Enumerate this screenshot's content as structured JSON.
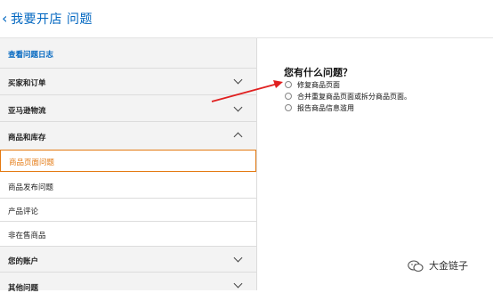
{
  "header": {
    "back_icon": "chevron-left-icon",
    "title": "我要开店 问题"
  },
  "sidebar": {
    "log_link": "查看问题日志",
    "sections": [
      {
        "label": "买家和订单",
        "expanded": false
      },
      {
        "label": "亚马逊物流",
        "expanded": false
      },
      {
        "label": "商品和库存",
        "expanded": true
      }
    ],
    "sub_items": [
      {
        "label": "商品页面问题",
        "selected": true
      },
      {
        "label": "商品发布问题",
        "selected": false
      },
      {
        "label": "产品评论",
        "selected": false
      },
      {
        "label": "非在售商品",
        "selected": false
      }
    ],
    "bottom_sections": [
      {
        "label": "您的账户",
        "expanded": false
      },
      {
        "label": "其他问题",
        "expanded": false
      }
    ]
  },
  "main": {
    "question": "您有什么问题？",
    "options": [
      {
        "label": "修复商品页面",
        "selected": false
      },
      {
        "label": "合并重复商品页面或拆分商品页面。",
        "selected": false
      },
      {
        "label": "报告商品信息滥用",
        "selected": false
      }
    ]
  },
  "annotation": {
    "arrow_color": "#e02020"
  },
  "watermark": {
    "icon": "wechat-icon",
    "text": "大金链子"
  },
  "colors": {
    "link": "#0066c0",
    "active": "#e47911",
    "sidebar_bg": "#f3f3f3"
  }
}
